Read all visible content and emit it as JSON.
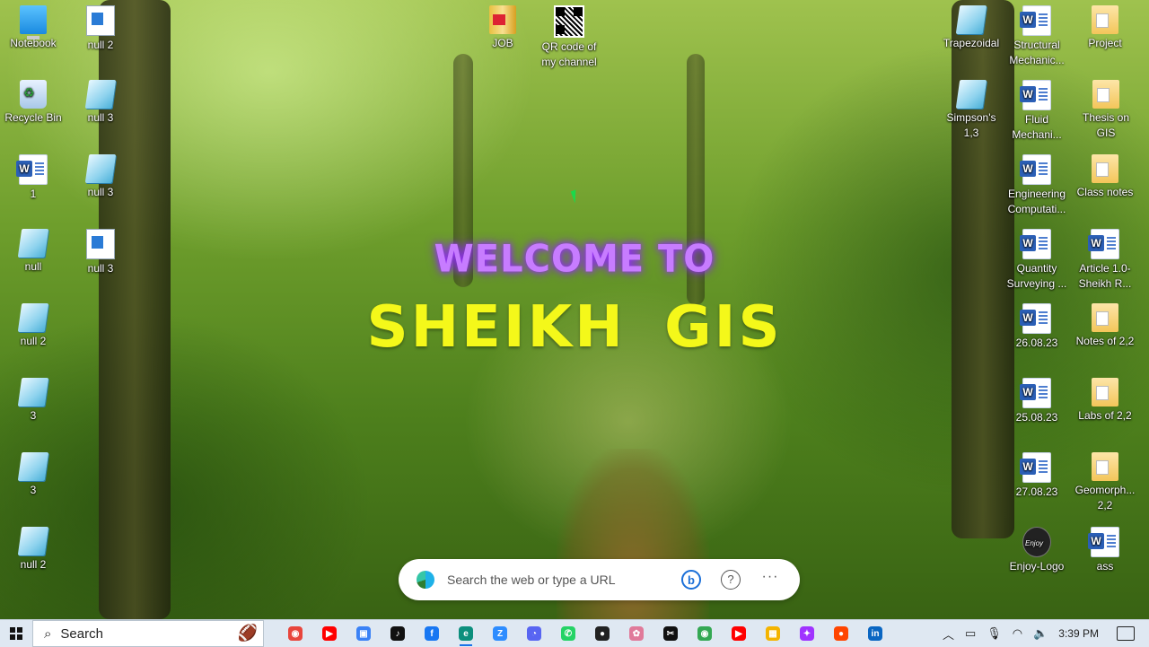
{
  "headline": {
    "welcome": "WELCOME TO",
    "brand": "SHEIKH  GIS"
  },
  "desktop_icons": {
    "col1": [
      {
        "label": "Notebook",
        "icon": "pc-icon"
      },
      {
        "label": "Recycle Bin",
        "icon": "recycle-bin-icon"
      },
      {
        "label": "1",
        "icon": "word-doc-icon"
      },
      {
        "label": "null",
        "icon": "note-icon"
      },
      {
        "label": "null 2",
        "icon": "note-icon"
      },
      {
        "label": "3",
        "icon": "note-icon"
      },
      {
        "label": "3",
        "icon": "note-icon"
      },
      {
        "label": "null 2",
        "icon": "note-icon"
      }
    ],
    "col2": [
      {
        "label": "null 2",
        "icon": "app-icon"
      },
      {
        "label": "null 3",
        "icon": "note-icon"
      },
      {
        "label": "null 3",
        "icon": "note-icon"
      },
      {
        "label": "null 3",
        "icon": "app-icon"
      }
    ],
    "top": [
      {
        "label": "JOB",
        "icon": "book-icon"
      },
      {
        "label": "QR code of my channel",
        "icon": "qr-code-icon"
      }
    ],
    "col_r1": [
      {
        "label": "Trapezoidal",
        "icon": "note-icon"
      },
      {
        "label": "Simpson's 1,3",
        "icon": "note-icon"
      }
    ],
    "col_r2": [
      {
        "label": "Structural Mechanic...",
        "icon": "word-doc-icon"
      },
      {
        "label": "Fluid Mechani...",
        "icon": "word-doc-icon"
      },
      {
        "label": "Engineering Computati...",
        "icon": "word-doc-icon"
      },
      {
        "label": "Quantity Surveying ...",
        "icon": "word-doc-icon"
      },
      {
        "label": "26.08.23",
        "icon": "word-doc-icon"
      },
      {
        "label": "25.08.23",
        "icon": "word-doc-icon"
      },
      {
        "label": "27.08.23",
        "icon": "word-doc-icon"
      },
      {
        "label": "Enjoy-Logo",
        "icon": "enjoy-logo-icon"
      }
    ],
    "col_r3": [
      {
        "label": "Project",
        "icon": "folder-icon"
      },
      {
        "label": "Thesis on GIS",
        "icon": "folder-icon"
      },
      {
        "label": "Class notes",
        "icon": "folder-icon"
      },
      {
        "label": "Article 1.0-Sheikh R...",
        "icon": "word-doc-icon"
      },
      {
        "label": "Notes of 2,2",
        "icon": "folder-icon"
      },
      {
        "label": "Labs of 2,2",
        "icon": "folder-icon"
      },
      {
        "label": "Geomorph... 2,2",
        "icon": "folder-icon"
      },
      {
        "label": "ass",
        "icon": "word-doc-icon"
      }
    ]
  },
  "search_bar": {
    "placeholder": "Search the web or type a URL"
  },
  "taskbar": {
    "search_label": "Search",
    "apps": [
      {
        "name": "chrome",
        "color": "#e8453c",
        "glyph": "◉",
        "active": false
      },
      {
        "name": "youtube",
        "color": "#ff0000",
        "glyph": "▶",
        "active": false
      },
      {
        "name": "app",
        "color": "#3b82f6",
        "glyph": "▣",
        "active": false
      },
      {
        "name": "tiktok",
        "color": "#111111",
        "glyph": "♪",
        "active": false
      },
      {
        "name": "facebook",
        "color": "#1877f2",
        "glyph": "f",
        "active": false
      },
      {
        "name": "edge",
        "color": "#0c8f7d",
        "glyph": "e",
        "active": true
      },
      {
        "name": "zoom",
        "color": "#2d8cff",
        "glyph": "Z",
        "active": false
      },
      {
        "name": "discord",
        "color": "#5865f2",
        "glyph": "◔",
        "active": false
      },
      {
        "name": "whatsapp",
        "color": "#25d366",
        "glyph": "✆",
        "active": false
      },
      {
        "name": "app",
        "color": "#222222",
        "glyph": "●",
        "active": false
      },
      {
        "name": "app",
        "color": "#e07a9a",
        "glyph": "✿",
        "active": false
      },
      {
        "name": "capcut",
        "color": "#111111",
        "glyph": "✂",
        "active": false
      },
      {
        "name": "chrome",
        "color": "#34a853",
        "glyph": "◉",
        "active": false
      },
      {
        "name": "youtube",
        "color": "#ff0000",
        "glyph": "▶",
        "active": false
      },
      {
        "name": "app",
        "color": "#f4b400",
        "glyph": "▦",
        "active": false
      },
      {
        "name": "messenger",
        "color": "#a033ff",
        "glyph": "✦",
        "active": false
      },
      {
        "name": "reddit",
        "color": "#ff4500",
        "glyph": "●",
        "active": false
      },
      {
        "name": "linkedin",
        "color": "#0a66c2",
        "glyph": "in",
        "active": false
      }
    ],
    "clock": "3:39 PM"
  }
}
